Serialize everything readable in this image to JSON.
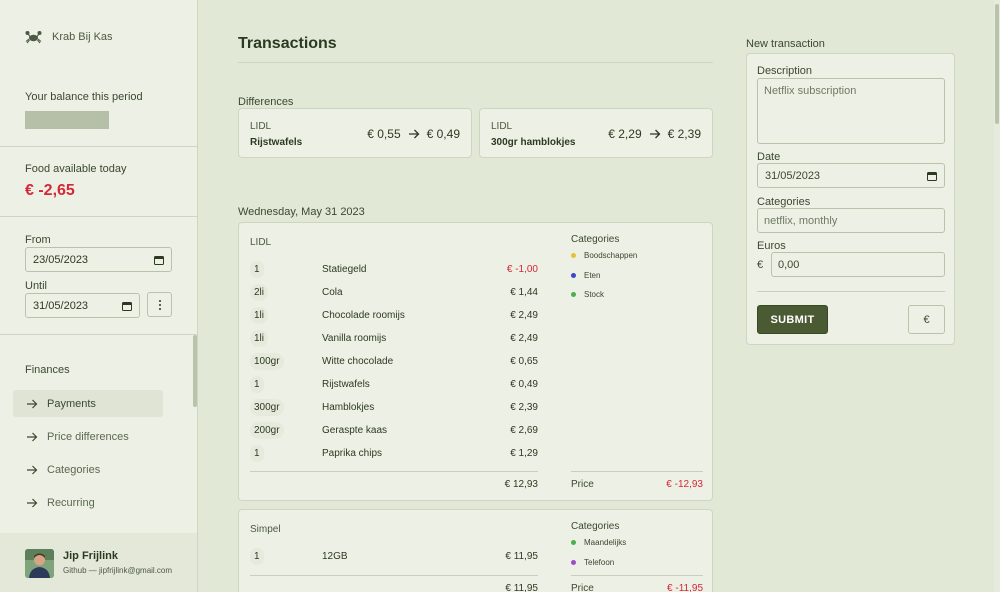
{
  "app": {
    "name": "Krab Bij Kas"
  },
  "sidebar": {
    "balance_label": "Your balance this period",
    "food_label": "Food available today",
    "food_value": "€ -2,65",
    "from_label": "From",
    "from_value": "23/05/2023",
    "until_label": "Until",
    "until_value": "31/05/2023",
    "nav_heading": "Finances",
    "nav_items": [
      {
        "label": "Payments",
        "active": true
      },
      {
        "label": "Price differences",
        "active": false
      },
      {
        "label": "Categories",
        "active": false
      },
      {
        "label": "Recurring",
        "active": false
      }
    ],
    "user": {
      "name": "Jip Frijlink",
      "subtitle": "Github — jipfrijlink@gmail.com"
    }
  },
  "main": {
    "title": "Transactions",
    "differences_label": "Differences",
    "differences": [
      {
        "store": "LIDL",
        "product": "Rijstwafels",
        "old_price": "€ 0,55",
        "new_price": "€ 0,49"
      },
      {
        "store": "LIDL",
        "product": "300gr hamblokjes",
        "old_price": "€ 2,29",
        "new_price": "€ 2,39"
      }
    ],
    "date_label": "Wednesday, May 31 2023",
    "transactions": [
      {
        "store": "LIDL",
        "items": [
          {
            "qty": "1",
            "name": "Statiegeld",
            "price": "€ -1,00",
            "negative": true
          },
          {
            "qty": "2li",
            "name": "Cola",
            "price": "€ 1,44",
            "negative": false
          },
          {
            "qty": "1li",
            "name": "Chocolade roomijs",
            "price": "€ 2,49",
            "negative": false
          },
          {
            "qty": "1li",
            "name": "Vanilla roomijs",
            "price": "€ 2,49",
            "negative": false
          },
          {
            "qty": "100gr",
            "name": "Witte chocolade",
            "price": "€ 0,65",
            "negative": false
          },
          {
            "qty": "1",
            "name": "Rijstwafels",
            "price": "€ 0,49",
            "negative": false
          },
          {
            "qty": "300gr",
            "name": "Hamblokjes",
            "price": "€ 2,39",
            "negative": false
          },
          {
            "qty": "200gr",
            "name": "Geraspte kaas",
            "price": "€ 2,69",
            "negative": false
          },
          {
            "qty": "1",
            "name": "Paprika chips",
            "price": "€ 1,29",
            "negative": false
          }
        ],
        "total": "€ 12,93",
        "categories_label": "Categories",
        "categories": [
          {
            "name": "Boodschappen",
            "color": "#e6c233"
          },
          {
            "name": "Eten",
            "color": "#3f47c9"
          },
          {
            "name": "Stock",
            "color": "#4cae4c"
          }
        ],
        "price_label": "Price",
        "price_value": "€ -12,93"
      },
      {
        "store": "Simpel",
        "items": [
          {
            "qty": "1",
            "name": "12GB",
            "price": "€ 11,95",
            "negative": false
          }
        ],
        "total": "€ 11,95",
        "categories_label": "Categories",
        "categories": [
          {
            "name": "Maandelijks",
            "color": "#4cae4c"
          },
          {
            "name": "Telefoon",
            "color": "#9a4cc9"
          }
        ],
        "price_label": "Price",
        "price_value": "€ -11,95"
      }
    ]
  },
  "form": {
    "heading": "New transaction",
    "description_label": "Description",
    "description_placeholder": "Netflix subscription",
    "date_label": "Date",
    "date_value": "31/05/2023",
    "categories_label": "Categories",
    "categories_placeholder": "netflix, monthly",
    "euros_label": "Euros",
    "euro_prefix": "€",
    "euros_value": "0,00",
    "submit_label": "SUBMIT",
    "currency_button": "€"
  },
  "colors": {
    "accent": "#4a5a32",
    "negative": "#d42838",
    "background": "#e1e8d6",
    "surface": "#edf0e4"
  }
}
